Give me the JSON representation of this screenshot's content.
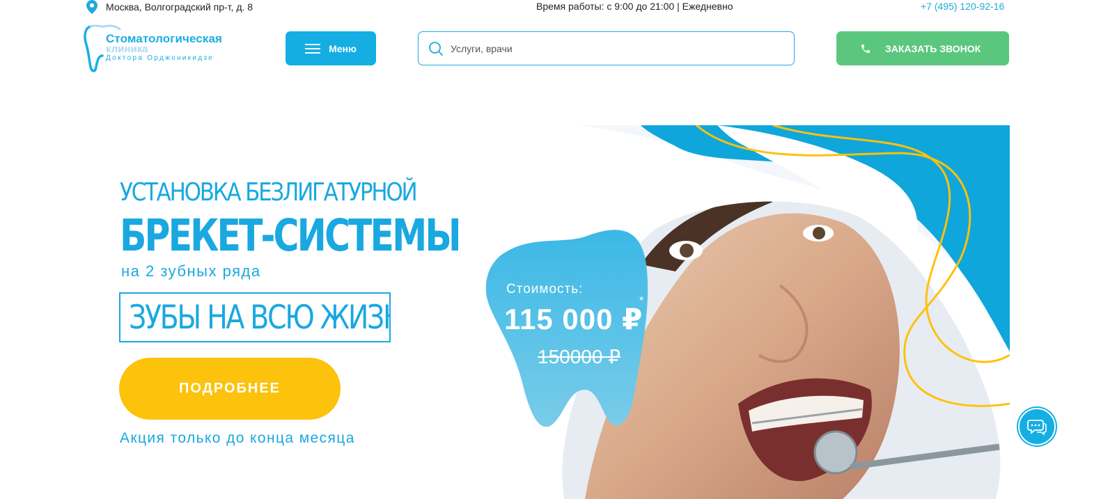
{
  "header": {
    "address": "Москва, Волгоградский пр-т, д. 8",
    "hours": "Время работы: с 9:00 до 21:00 | Ежедневно",
    "phone": "+7 (495) 120-92-16",
    "logo": {
      "line1": "Стоматологическая",
      "line2": "клиника",
      "line3": "Доктора Орджоникидзе"
    },
    "menu_label": "Меню",
    "search_placeholder": "Услуги, врачи",
    "callback_label": "ЗАКАЗАТЬ ЗВОНОК"
  },
  "hero": {
    "line1": "УСТАНОВКА БЕЗЛИГАТУРНОЙ",
    "line2": "БРЕКЕТ-СИСТЕМЫ",
    "line3": "на 2 зубных ряда",
    "slogan": "ЗУБЫ НА ВСЮ ЖИЗНЬ!",
    "button_label": "ПОДРОБНЕЕ",
    "promo_note": "Акция только до конца месяца",
    "price_label": "Стоимость:",
    "price": "115 000 ₽",
    "price_mark": "*",
    "old_price": "150000 ₽"
  },
  "colors": {
    "brand_blue": "#19a8e0",
    "yellow": "#fcc20c",
    "green": "#5bc77e"
  },
  "icons": [
    "location-pin-icon",
    "hamburger-icon",
    "search-icon",
    "phone-icon",
    "chat-icon"
  ]
}
